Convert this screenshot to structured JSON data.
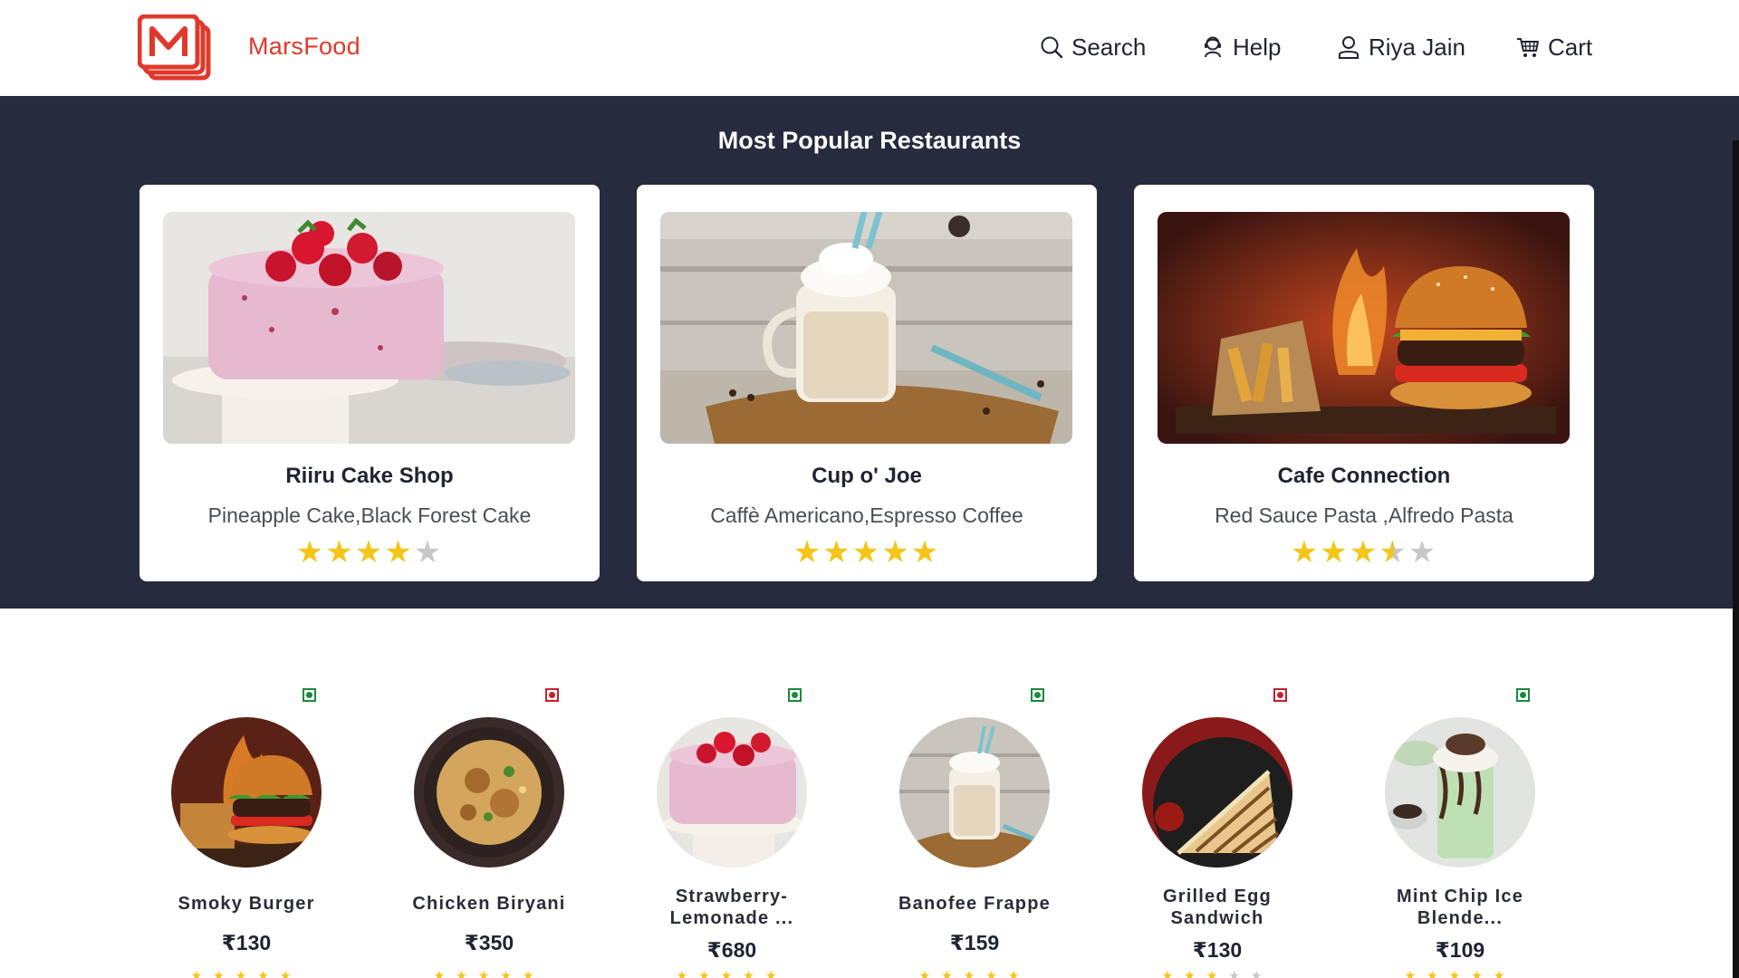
{
  "header": {
    "brand": "MarsFood",
    "nav": {
      "search": "Search",
      "help": "Help",
      "user": "Riya Jain",
      "cart": "Cart"
    }
  },
  "popular": {
    "title": "Most Popular Restaurants",
    "restaurants": [
      {
        "name": "Riiru Cake Shop",
        "dishes": "Pineapple Cake,Black Forest Cake",
        "rating": 4,
        "image": "strawberry-cake"
      },
      {
        "name": "Cup o' Joe",
        "dishes": "Caffè Americano,Espresso Coffee",
        "rating": 5,
        "image": "milkshake-jar"
      },
      {
        "name": "Cafe Connection",
        "dishes": "Red Sauce Pasta ,Alfredo Pasta",
        "rating": 3.5,
        "image": "burger-fries"
      }
    ]
  },
  "dishes": [
    {
      "name": "Smoky Burger",
      "price": "₹130",
      "veg": true,
      "image": "burger"
    },
    {
      "name": "Chicken Biryani",
      "price": "₹350",
      "veg": false,
      "image": "biryani"
    },
    {
      "name": "Strawberry-Lemonade ...",
      "price": "₹680",
      "veg": true,
      "image": "cake"
    },
    {
      "name": "Banofee Frappe",
      "price": "₹159",
      "veg": true,
      "image": "frappe"
    },
    {
      "name": "Grilled Egg Sandwich",
      "price": "₹130",
      "veg": false,
      "image": "sandwich"
    },
    {
      "name": "Mint Chip Ice Blende...",
      "price": "₹109",
      "veg": true,
      "image": "mint-shake"
    }
  ],
  "colors": {
    "brand": "#e0392b",
    "band": "#262b3d",
    "star": "#f5c518",
    "veg": "#1a8a3a",
    "nonveg": "#c8202b"
  }
}
